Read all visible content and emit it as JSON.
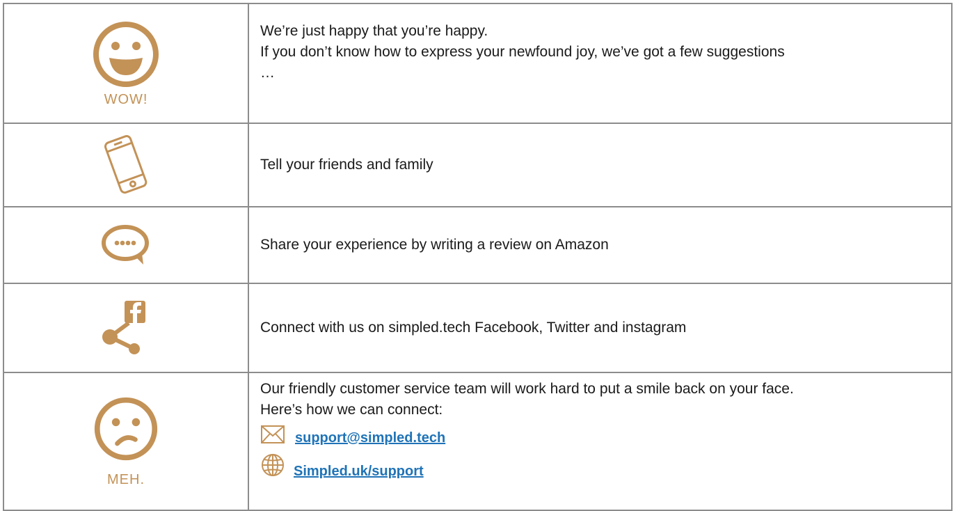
{
  "rows": [
    {
      "icon": "happy-face-icon",
      "caption": "WOW!",
      "lines": [
        "We’re just happy that you’re happy.",
        "If you don’t know how to express your newfound joy, we’ve got a few suggestions",
        "…"
      ]
    },
    {
      "icon": "smartphone-icon",
      "text": "Tell your friends and family"
    },
    {
      "icon": "speech-bubble-icon",
      "text": "Share your experience by writing a review on Amazon"
    },
    {
      "icon": "facebook-share-icon",
      "text": "Connect with us on simpled.tech Facebook, Twitter and instagram"
    },
    {
      "icon": "unhappy-face-icon",
      "caption": "MEH.",
      "lines": [
        "Our friendly customer service team will work hard to put a smile back on your face.",
        "Here’s how we can connect:"
      ],
      "contacts": [
        {
          "icon": "envelope-icon",
          "label": "support@simpled.tech"
        },
        {
          "icon": "globe-icon",
          "label": "Simpled.uk/support"
        }
      ]
    }
  ],
  "colors": {
    "icon": "#c39257",
    "link": "#1f73b7",
    "border": "#8c8c8c"
  }
}
